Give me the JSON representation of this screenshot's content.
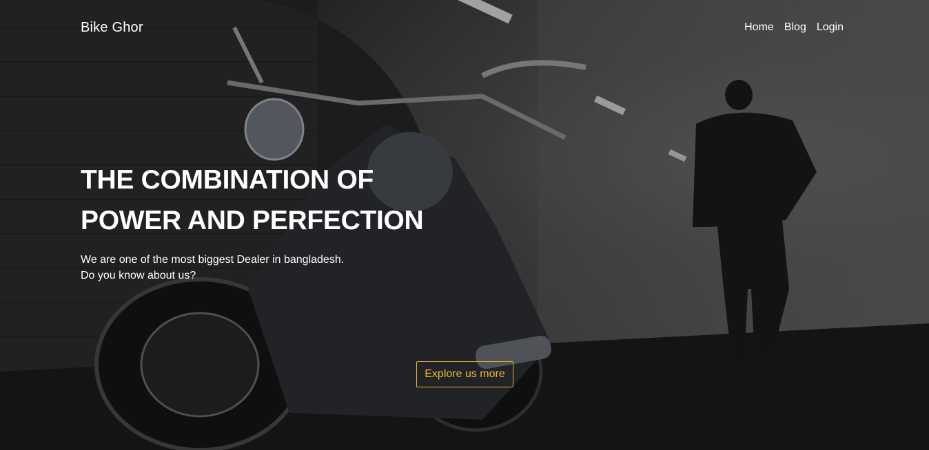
{
  "navbar": {
    "brand": "Bike Ghor",
    "links": [
      {
        "label": "Home"
      },
      {
        "label": "Blog"
      },
      {
        "label": "Login"
      }
    ]
  },
  "hero": {
    "headline_line1": "THE COMBINATION OF",
    "headline_line2": "POWER AND PERFECTION",
    "subtext_line1": "We are one of the most biggest Dealer in bangladesh.",
    "subtext_line2": "Do you know about us?",
    "cta_label": "Explore us more",
    "accent_color": "#f0b936",
    "background_image": "motorcycle-in-tunnel-photo"
  }
}
